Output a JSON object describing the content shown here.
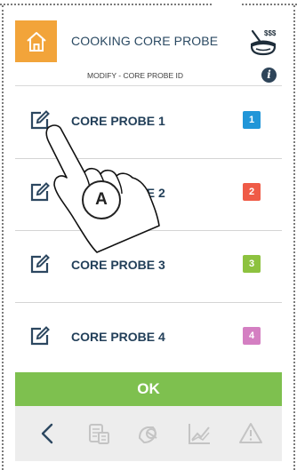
{
  "header": {
    "title": "COOKING CORE PROBE",
    "home_icon": "home-icon",
    "probe_icon": "core-probe-icon",
    "home_color": "#f2a43a"
  },
  "subheader": {
    "title": "MODIFY - CORE PROBE ID",
    "info_icon": "info-icon",
    "info_glyph": "i"
  },
  "probes": [
    {
      "label": "CORE PROBE 1",
      "number": "1",
      "color": "#2196d8",
      "icon": "edit-icon"
    },
    {
      "label": "CORE PROBE 2",
      "number": "2",
      "color": "#ef5b47",
      "icon": "edit-icon"
    },
    {
      "label": "CORE PROBE 3",
      "number": "3",
      "color": "#8dc23f",
      "icon": "edit-icon"
    },
    {
      "label": "CORE PROBE 4",
      "number": "4",
      "color": "#d47fc2",
      "icon": "edit-icon"
    }
  ],
  "ok_button": {
    "label": "OK",
    "color": "#7ec04f"
  },
  "bottom_bar": {
    "items": [
      "back-icon",
      "recipe-book-icon",
      "tags-icon",
      "chart-icon",
      "warning-icon"
    ]
  },
  "callout": {
    "label": "A"
  }
}
